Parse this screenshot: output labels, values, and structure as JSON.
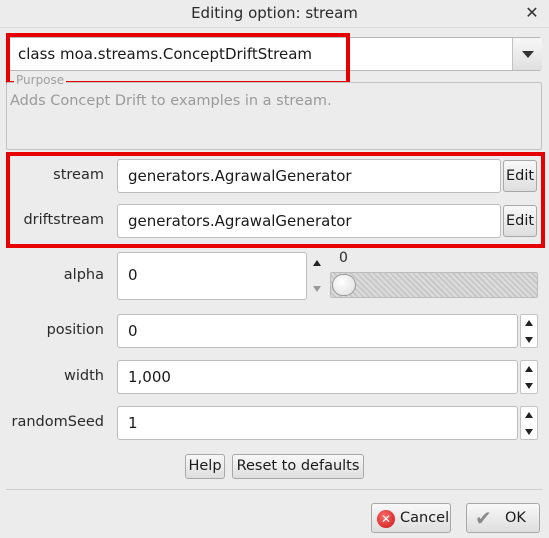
{
  "window": {
    "title": "Editing option: stream",
    "close_glyph": "✕"
  },
  "class_selector": {
    "value": "class moa.streams.ConceptDriftStream"
  },
  "purpose": {
    "legend": "Purpose",
    "text": "Adds Concept Drift to examples in a stream."
  },
  "options": {
    "stream": {
      "label": "stream",
      "value": "generators.AgrawalGenerator",
      "edit_label": "Edit"
    },
    "driftstream": {
      "label": "driftstream",
      "value": "generators.AgrawalGenerator",
      "edit_label": "Edit"
    },
    "alpha": {
      "label": "alpha",
      "value": "0",
      "slider_value": "0"
    },
    "position": {
      "label": "position",
      "value": "0"
    },
    "width": {
      "label": "width",
      "value": "1,000"
    },
    "randomSeed": {
      "label": "randomSeed",
      "value": "1"
    }
  },
  "buttons": {
    "help": "Help",
    "reset": "Reset to defaults",
    "cancel": "Cancel",
    "ok": "OK"
  },
  "colors": {
    "highlight": "#e60000",
    "background": "#ececec"
  },
  "icons": {
    "cancel": "cancel-icon",
    "ok": "checkmark-icon",
    "dropdown": "chevron-down-icon"
  }
}
